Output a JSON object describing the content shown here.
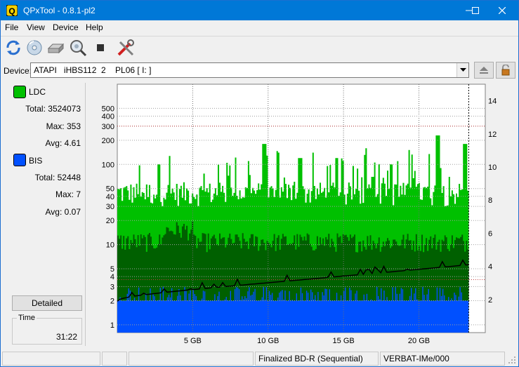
{
  "window": {
    "title": "QPxTool - 0.8.1-pl2",
    "minimize_glyph": "—",
    "maximize_glyph": "☐",
    "close_glyph": "✕"
  },
  "menu": [
    "File",
    "View",
    "Device",
    "Help"
  ],
  "toolbar": {
    "icons": [
      "refresh-icon",
      "disc-info-icon",
      "drive-icon",
      "scan-search-icon",
      "stop-icon",
      "tools-icon"
    ]
  },
  "device": {
    "label": "Device:",
    "value": "ATAPI   iHBS112  2    PL06 [ I: ]",
    "eject_icon": "eject-icon",
    "lock_icon": "lock-icon"
  },
  "stats": {
    "ldc": {
      "name": "LDC",
      "color": "#00c000",
      "total_label": "Total:",
      "total": "3524073",
      "max_label": "Max:",
      "max": "353",
      "avg_label": "Avg:",
      "avg": "4.61"
    },
    "bis": {
      "name": "BIS",
      "color": "#0050ff",
      "total_label": "Total:",
      "total": "52448",
      "max_label": "Max:",
      "max": "7",
      "avg_label": "Avg:",
      "avg": "0.07"
    },
    "detailed_button": "Detailed",
    "time_label": "Time",
    "time_value": "31:22"
  },
  "chart_data": {
    "type": "area",
    "x_axis": {
      "unit": "GB",
      "range": [
        0,
        24.4
      ],
      "ticks": [
        "5 GB",
        "10 GB",
        "15 GB",
        "20 GB"
      ],
      "tick_values": [
        5,
        10,
        15,
        20
      ],
      "data_end": 23.3
    },
    "y_left": {
      "scale": "log",
      "range": [
        0.8,
        1000
      ],
      "ticks": [
        "1",
        "2",
        "3",
        "4",
        "5",
        "10",
        "20",
        "30",
        "40",
        "50",
        "100",
        "200",
        "300",
        "400",
        "500"
      ],
      "tick_values": [
        1,
        2,
        3,
        4,
        5,
        10,
        20,
        30,
        40,
        50,
        100,
        200,
        300,
        400,
        500
      ]
    },
    "y_right": {
      "range": [
        0,
        15
      ],
      "ticks": [
        "2",
        "4",
        "6",
        "8",
        "10",
        "12",
        "14"
      ],
      "tick_values": [
        2,
        4,
        6,
        8,
        10,
        12,
        14
      ]
    },
    "threshold_lines": {
      "left_300": 300,
      "right_3": 3.2
    },
    "series": [
      {
        "name": "LDC",
        "color": "#00c000",
        "band_low": [
          10,
          20
        ],
        "band_high": [
          30,
          60
        ],
        "peaks": [
          [
            2.7,
            100
          ],
          [
            9.7,
            180
          ],
          [
            12.1,
            120
          ],
          [
            14.5,
            120
          ],
          [
            16.9,
            70
          ],
          [
            18.1,
            100
          ],
          [
            21.2,
            230
          ],
          [
            23.0,
            180
          ],
          [
            23.4,
            100
          ]
        ]
      },
      {
        "name": "LDC-dark",
        "color": "#006000",
        "band": [
          2,
          10
        ]
      },
      {
        "name": "BIS",
        "color": "#0050ff",
        "base": 2,
        "spikes_to": 3
      },
      {
        "name": "Speed",
        "color": "#000000",
        "start": 1.9,
        "end": 4.1,
        "unit": "x"
      }
    ]
  },
  "status": {
    "cells": [
      "",
      "",
      "",
      "Finalized BD-R (Sequential)",
      "VERBAT-IMe/000"
    ]
  }
}
